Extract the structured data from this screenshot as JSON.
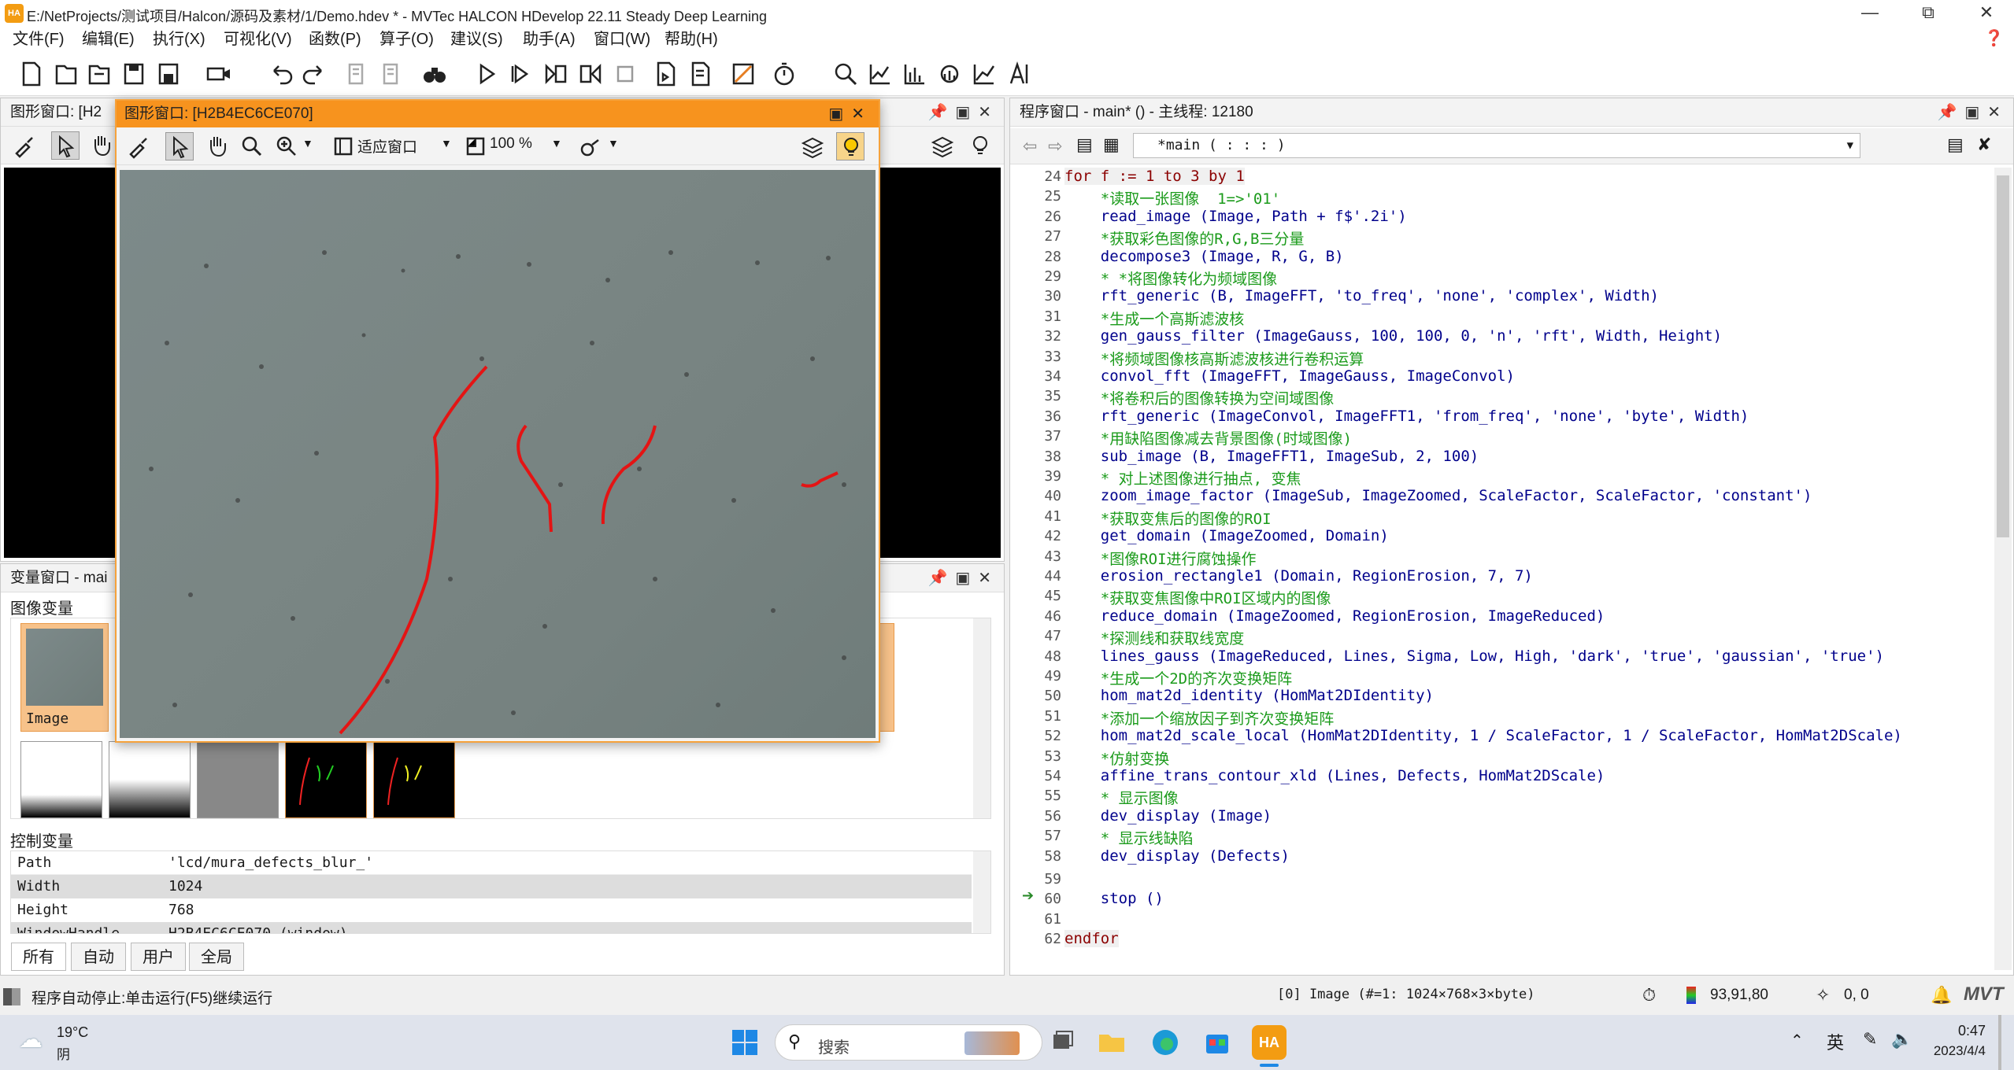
{
  "window": {
    "title": "E:/NetProjects/测试项目/Halcon/源码及素材/1/Demo.hdev * - MVTec HALCON HDevelop 22.11 Steady Deep Learning",
    "app_logo": "HA"
  },
  "menu": [
    "文件(F)",
    "编辑(E)",
    "执行(X)",
    "可视化(V)",
    "函数(P)",
    "算子(O)",
    "建议(S)",
    "助手(A)",
    "窗口(W)",
    "帮助(H)"
  ],
  "graphics_window_bg": {
    "title": "图形窗口: [H2"
  },
  "graphics_window_float": {
    "title": "图形窗口: [H2B4EC6CE070]",
    "fit_label": "适应窗口",
    "zoom_label": "100 %"
  },
  "variables_window": {
    "title": "变量窗口 - mai",
    "image_vars_label": "图像变量",
    "image_thumb_label": "Image",
    "control_vars_label": "控制变量",
    "rows": [
      {
        "name": "Path",
        "value": "'lcd/mura_defects_blur_'"
      },
      {
        "name": "Width",
        "value": "1024"
      },
      {
        "name": "Height",
        "value": "768"
      },
      {
        "name": "WindowHandle",
        "value": "H2B4EC6CE070 (window)"
      }
    ],
    "tabs": [
      "所有",
      "自动",
      "用户",
      "全局"
    ]
  },
  "program_window": {
    "title": "程序窗口 - main* () - 主线程: 12180",
    "proc_select": "*main ( : : : )",
    "lines": [
      {
        "no": "24",
        "text": "for f := 1 to 3 by 1",
        "type": "for"
      },
      {
        "no": "25",
        "text": "    *读取一张图像  1=>'01'",
        "type": "cm"
      },
      {
        "no": "26",
        "text": "    read_image (Image, Path + f$'.2i')",
        "type": "fn"
      },
      {
        "no": "27",
        "text": "    *获取彩色图像的R,G,B三分量",
        "type": "cm"
      },
      {
        "no": "28",
        "text": "    decompose3 (Image, R, G, B)",
        "type": "fn"
      },
      {
        "no": "29",
        "text": "    * *将图像转化为频域图像",
        "type": "cm"
      },
      {
        "no": "30",
        "text": "    rft_generic (B, ImageFFT, 'to_freq', 'none', 'complex', Width)",
        "type": "fn"
      },
      {
        "no": "31",
        "text": "    *生成一个高斯滤波核",
        "type": "cm"
      },
      {
        "no": "32",
        "text": "    gen_gauss_filter (ImageGauss, 100, 100, 0, 'n', 'rft', Width, Height)",
        "type": "fn"
      },
      {
        "no": "33",
        "text": "    *将频域图像核高斯滤波核进行卷积运算",
        "type": "cm"
      },
      {
        "no": "34",
        "text": "    convol_fft (ImageFFT, ImageGauss, ImageConvol)",
        "type": "fn"
      },
      {
        "no": "35",
        "text": "    *将卷积后的图像转换为空间域图像",
        "type": "cm"
      },
      {
        "no": "36",
        "text": "    rft_generic (ImageConvol, ImageFFT1, 'from_freq', 'none', 'byte', Width)",
        "type": "fn"
      },
      {
        "no": "37",
        "text": "    *用缺陷图像减去背景图像(时域图像)",
        "type": "cm"
      },
      {
        "no": "38",
        "text": "    sub_image (B, ImageFFT1, ImageSub, 2, 100)",
        "type": "fn"
      },
      {
        "no": "39",
        "text": "    * 对上述图像进行抽点, 变焦",
        "type": "cm"
      },
      {
        "no": "40",
        "text": "    zoom_image_factor (ImageSub, ImageZoomed, ScaleFactor, ScaleFactor, 'constant')",
        "type": "fn"
      },
      {
        "no": "41",
        "text": "    *获取变焦后的图像的ROI",
        "type": "cm"
      },
      {
        "no": "42",
        "text": "    get_domain (ImageZoomed, Domain)",
        "type": "fn"
      },
      {
        "no": "43",
        "text": "    *图像ROI进行腐蚀操作",
        "type": "cm"
      },
      {
        "no": "44",
        "text": "    erosion_rectangle1 (Domain, RegionErosion, 7, 7)",
        "type": "fn"
      },
      {
        "no": "45",
        "text": "    *获取变焦图像中ROI区域内的图像",
        "type": "cm"
      },
      {
        "no": "46",
        "text": "    reduce_domain (ImageZoomed, RegionErosion, ImageReduced)",
        "type": "fn"
      },
      {
        "no": "47",
        "text": "    *探测线和获取线宽度",
        "type": "cm"
      },
      {
        "no": "48",
        "text": "    lines_gauss (ImageReduced, Lines, Sigma, Low, High, 'dark', 'true', 'gaussian', 'true')",
        "type": "fn"
      },
      {
        "no": "49",
        "text": "    *生成一个2D的齐次变换矩阵",
        "type": "cm"
      },
      {
        "no": "50",
        "text": "    hom_mat2d_identity (HomMat2DIdentity)",
        "type": "fn"
      },
      {
        "no": "51",
        "text": "    *添加一个缩放因子到齐次变换矩阵",
        "type": "cm"
      },
      {
        "no": "52",
        "text": "    hom_mat2d_scale_local (HomMat2DIdentity, 1 / ScaleFactor, 1 / ScaleFactor, HomMat2DScale)",
        "type": "fn"
      },
      {
        "no": "53",
        "text": "    *仿射变换",
        "type": "cm"
      },
      {
        "no": "54",
        "text": "    affine_trans_contour_xld (Lines, Defects, HomMat2DScale)",
        "type": "fn"
      },
      {
        "no": "55",
        "text": "    * 显示图像",
        "type": "cm"
      },
      {
        "no": "56",
        "text": "    dev_display (Image)",
        "type": "fn"
      },
      {
        "no": "57",
        "text": "    * 显示线缺陷",
        "type": "cm"
      },
      {
        "no": "58",
        "text": "    dev_display (Defects)",
        "type": "fn"
      },
      {
        "no": "59",
        "text": "",
        "type": "fn"
      },
      {
        "no": "60",
        "text": "    stop ()",
        "type": "fn"
      },
      {
        "no": "61",
        "text": "",
        "type": "fn"
      },
      {
        "no": "62",
        "text": "endfor",
        "type": "endfor"
      }
    ]
  },
  "status": {
    "message": "程序自动停止:单击运行(F5)继续运行",
    "image_info": "[0] Image (#=1: 1024×768×3×byte)",
    "pixel_value": "93,91,80",
    "coords": "0, 0"
  },
  "taskbar": {
    "temperature": "19°C",
    "weather": "阴",
    "search_placeholder": "搜索",
    "ime": "英",
    "time": "0:47",
    "date": "2023/4/4"
  }
}
